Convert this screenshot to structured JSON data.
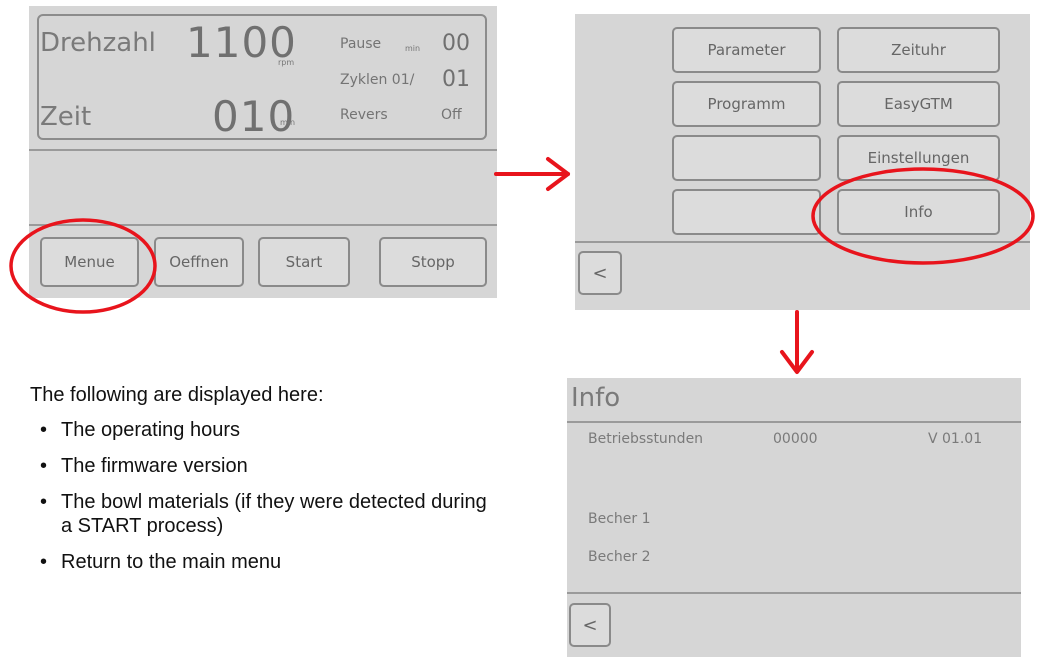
{
  "screen1": {
    "speed_label": "Drehzahl",
    "speed_value": "1100",
    "speed_unit": "rpm",
    "time_label": "Zeit",
    "time_value": "010",
    "time_unit": "min",
    "pause_label": "Pause",
    "pause_unit": "min",
    "pause_value": "00",
    "cycles_label": "Zyklen 01/",
    "cycles_value": "01",
    "reverse_label": "Revers",
    "reverse_value": "Off",
    "buttons": {
      "menu": "Menue",
      "open": "Oeffnen",
      "start": "Start",
      "stop": "Stopp"
    }
  },
  "screen2": {
    "buttons": {
      "parameter": "Parameter",
      "timer": "Zeituhr",
      "program": "Programm",
      "easygtm": "EasyGTM",
      "empty1": "",
      "settings": "Einstellungen",
      "empty2": "",
      "info": "Info"
    },
    "back_glyph": "<"
  },
  "screen3": {
    "title": "Info",
    "hours_label": "Betriebsstunden",
    "hours_value": "00000",
    "version": "V 01.01",
    "bowl1": "Becher 1",
    "bowl2": "Becher 2",
    "back_glyph": "<"
  },
  "text": {
    "intro": "The following are displayed here:",
    "bullets": [
      "The operating hours",
      "The firmware version",
      "The bowl materials (if they were detected during a START process)",
      "Return to the main menu"
    ]
  },
  "colors": {
    "annotation_red": "#e8141c",
    "lcd_background": "#d6d6d6"
  },
  "icons": [
    "arrow-right-icon",
    "arrow-down-icon",
    "back-chevron-icon"
  ]
}
